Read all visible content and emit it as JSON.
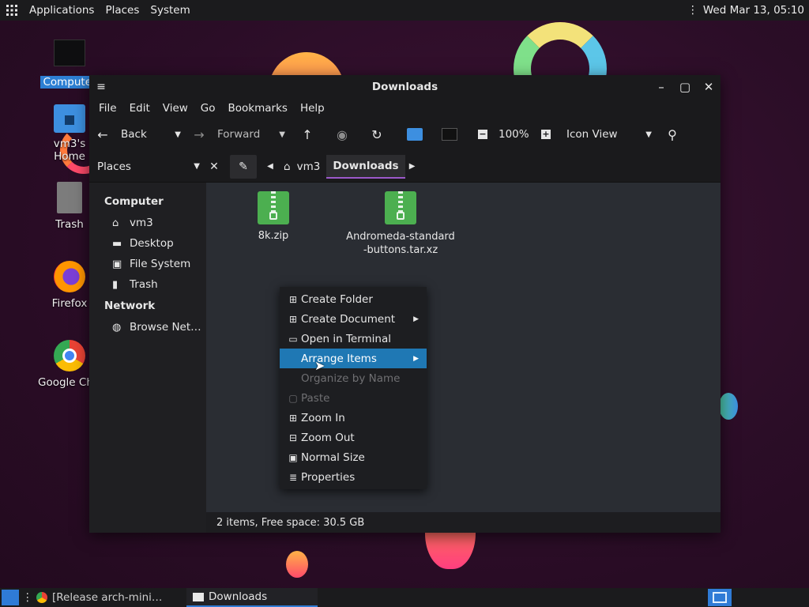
{
  "top_panel": {
    "applications": "Applications",
    "places": "Places",
    "system": "System",
    "clock": "Wed Mar 13, 05:10"
  },
  "desktop": {
    "icons": [
      {
        "label": "Computer",
        "icon": "computer-icon",
        "selected": true
      },
      {
        "label": "vm3's Home",
        "icon": "home-folder-icon"
      },
      {
        "label": "Trash",
        "icon": "trash-icon"
      },
      {
        "label": "Firefox",
        "icon": "firefox-icon"
      },
      {
        "label": "Google Chrome",
        "icon": "chrome-icon"
      }
    ]
  },
  "window": {
    "title": "Downloads",
    "menu": [
      "File",
      "Edit",
      "View",
      "Go",
      "Bookmarks",
      "Help"
    ],
    "toolbar": {
      "back": "Back",
      "forward": "Forward",
      "zoom": "100%",
      "view": "Icon View"
    },
    "location": {
      "side_pane": "Places",
      "crumbs": [
        "vm3",
        "Downloads"
      ]
    },
    "sidebar": {
      "computer_heading": "Computer",
      "computer_items": [
        {
          "label": "vm3",
          "icon": "home-icon"
        },
        {
          "label": "Desktop",
          "icon": "desktop-icon"
        },
        {
          "label": "File System",
          "icon": "drive-icon"
        },
        {
          "label": "Trash",
          "icon": "trash-icon"
        }
      ],
      "network_heading": "Network",
      "network_items": [
        {
          "label": "Browse Net…",
          "icon": "network-icon"
        }
      ]
    },
    "files": [
      {
        "name": "8k.zip",
        "icon": "zip-archive-icon"
      },
      {
        "name": "Andromeda-standard-buttons.tar.xz",
        "icon": "zip-archive-icon"
      }
    ],
    "status": "2 items, Free space: 30.5 GB"
  },
  "context_menu": {
    "items": [
      {
        "label": "Create Folder",
        "icon": "add-folder-icon",
        "submenu": false
      },
      {
        "label": "Create Document",
        "icon": "add-document-icon",
        "submenu": true
      },
      {
        "label": "Open in Terminal",
        "icon": "terminal-icon",
        "submenu": false
      },
      {
        "label": "Arrange Items",
        "icon": "",
        "submenu": true,
        "highlighted": true
      },
      {
        "label": "Organize by Name",
        "icon": "",
        "disabled": true
      },
      {
        "label": "Paste",
        "icon": "paste-icon",
        "disabled": true
      },
      {
        "label": "Zoom In",
        "icon": "zoom-in-icon"
      },
      {
        "label": "Zoom Out",
        "icon": "zoom-out-icon"
      },
      {
        "label": "Normal Size",
        "icon": "normal-size-icon"
      },
      {
        "label": "Properties",
        "icon": "properties-icon"
      }
    ]
  },
  "taskbar": {
    "tasks": [
      {
        "label": "[Release arch-mini…",
        "icon": "chrome-icon"
      },
      {
        "label": "Downloads",
        "icon": "folder-icon",
        "active": true
      }
    ]
  }
}
